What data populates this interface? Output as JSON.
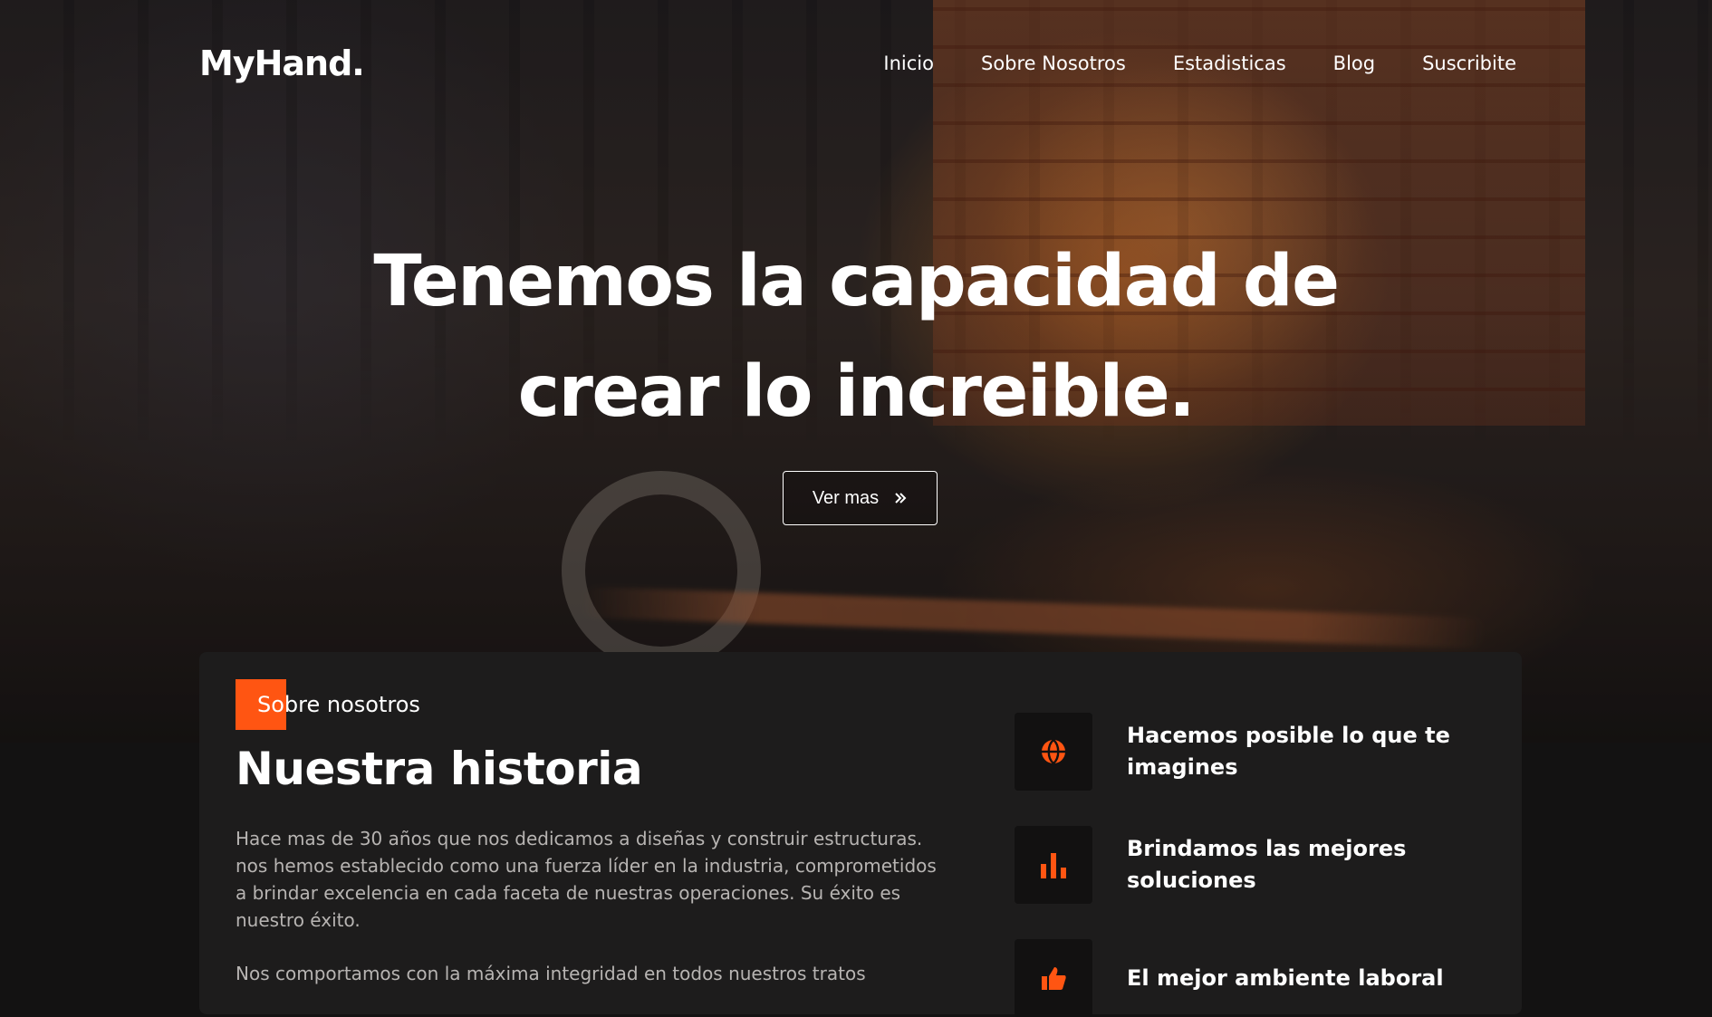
{
  "brand": {
    "logo": "MyHand."
  },
  "nav": {
    "items": [
      {
        "label": "Inicio"
      },
      {
        "label": "Sobre Nosotros"
      },
      {
        "label": "Estadisticas"
      },
      {
        "label": "Blog"
      },
      {
        "label": "Suscribite"
      }
    ]
  },
  "hero": {
    "headline_line1": "Tenemos la capacidad de",
    "headline_line2": "crear lo increible.",
    "cta_label": "Ver mas",
    "cta_icon": "double-chevron-right-icon"
  },
  "about": {
    "tag": "Sobre nosotros",
    "title": "Nuestra historia",
    "paragraph1": "Hace mas de 30 años que nos dedicamos a diseñas y construir estructuras. nos hemos establecido como una fuerza líder en la industria, comprometidos a brindar excelencia en cada faceta de nuestras operaciones. Su éxito es nuestro éxito.",
    "paragraph2": "Nos comportamos con la máxima integridad en todos nuestros tratos",
    "features": [
      {
        "icon": "globe-icon",
        "text": "Hacemos posible lo que te imagines"
      },
      {
        "icon": "bar-chart-icon",
        "text": "Brindamos las mejores soluciones"
      },
      {
        "icon": "thumbs-up-icon",
        "text": "El mejor ambiente laboral"
      }
    ]
  },
  "colors": {
    "accent": "#ff5512",
    "background": "#131212",
    "card": "#1d1c1c",
    "icon_box": "#121111",
    "muted_text": "#b7b4b2"
  }
}
